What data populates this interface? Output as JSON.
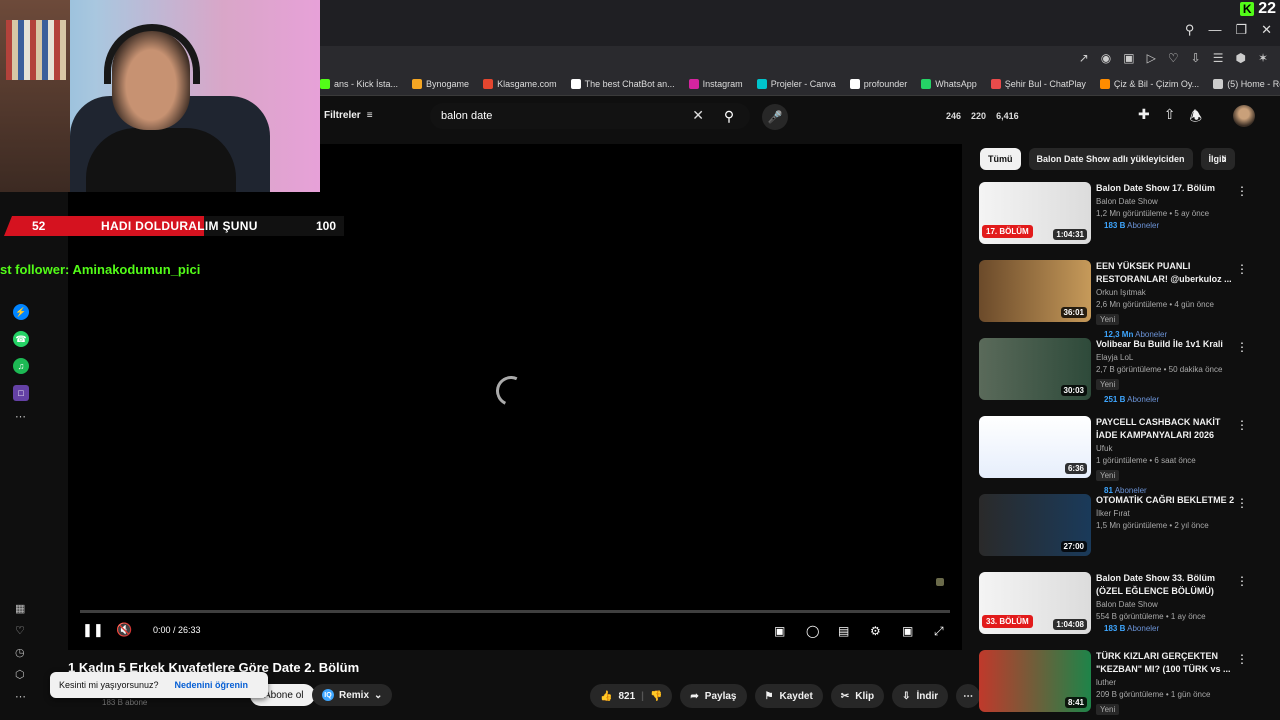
{
  "browser": {
    "kick_count": "22",
    "bookmarks": [
      {
        "label": "ans - Kick İsta...",
        "color": "#53fc18"
      },
      {
        "label": "Bynogame",
        "color": "#f5a623"
      },
      {
        "label": "Klasgame.com",
        "color": "#e3462f"
      },
      {
        "label": "The best ChatBot an...",
        "color": "#ffffff"
      },
      {
        "label": "Instagram",
        "color": "#d6249f"
      },
      {
        "label": "Projeler - Canva",
        "color": "#00c4cc"
      },
      {
        "label": "profounder",
        "color": "#ffffff"
      },
      {
        "label": "WhatsApp",
        "color": "#25d366"
      },
      {
        "label": "Şehir Bul - ChatPlay",
        "color": "#e94b4b"
      },
      {
        "label": "Çiz & Bil - Çizim Oy...",
        "color": "#ff8c00"
      },
      {
        "label": "(5) Home - Roblox",
        "color": "#cccccc"
      }
    ]
  },
  "header": {
    "filters_label": "Filtreler",
    "search_value": "balon date",
    "stats": [
      "246",
      "220",
      "6,416"
    ]
  },
  "overlay": {
    "goal_current": "52",
    "goal_label": "HADI DOLDURALIM ŞUNU",
    "goal_max": "100",
    "goal_fraction": 0.52,
    "last_follower": "st follower: Aminakodumun_pici"
  },
  "player": {
    "time": "0:00 / 26:33",
    "title": "1 Kadın 5 Erkek Kıyafetlere Göre Date 2. Bölüm",
    "subscribers": "183 B abone"
  },
  "interrupt": {
    "question": "Kesinti mi yaşıyorsunuz?",
    "learn": "Nedenini öğrenin"
  },
  "below": {
    "subscribe_label": "Abone ol",
    "remix_label": "Remix",
    "like_count": "821",
    "share_label": "Paylaş",
    "save_label": "Kaydet",
    "clip_label": "Klip",
    "download_label": "İndir"
  },
  "chips": [
    "Tümü",
    "Balon Date Show adlı yükleyiciden",
    "İlgili"
  ],
  "recommendations": [
    {
      "title": "Balon Date Show 17. Bölüm",
      "channel": "Balon Date Show",
      "meta": "1,2 Mn görüntüleme • 5 ay önce",
      "subs": "183 B",
      "subs_label": "Aboneler",
      "duration": "1:04:31",
      "tag": "17. BÖLÜM",
      "new": "",
      "thumb": "linear-gradient(90deg,#f4f4f4,#dcdcdc)"
    },
    {
      "title": "EEN YÜKSEK PUANLI RESTORANLAR! @uberkuloz ...",
      "channel": "Orkun Işıtmak",
      "meta": "2,6 Mn görüntüleme • 4 gün önce",
      "subs": "12,3 Mn",
      "subs_label": "Aboneler",
      "duration": "36:01",
      "tag": "",
      "new": "Yeni",
      "thumb": "linear-gradient(90deg,#6b4a2a,#c69a5a)"
    },
    {
      "title": "Volibear Bu Build İle 1v1 Krali",
      "channel": "Elayja LoL",
      "meta": "2,7 B görüntüleme • 50 dakika önce",
      "subs": "251 B",
      "subs_label": "Aboneler",
      "duration": "30:03",
      "tag": "",
      "new": "Yeni",
      "thumb": "linear-gradient(90deg,#5a6a5a,#2e4a3a)"
    },
    {
      "title": "PAYCELL CASHBACK NAKİT İADE KAMPANYALARI 2026",
      "channel": "Ufuk",
      "meta": "1 görüntüleme • 6 saat önce",
      "subs": "81",
      "subs_label": "Aboneler",
      "duration": "6:36",
      "tag": "",
      "new": "Yeni",
      "thumb": "linear-gradient(180deg,#ffffff,#e6eefc)"
    },
    {
      "title": "OTOMATİK CAĞRI BEKLETME 2",
      "channel": "İlker Fırat",
      "meta": "1,5 Mn görüntüleme • 2 yıl önce",
      "subs": "",
      "subs_label": "",
      "duration": "27:00",
      "tag": "",
      "new": "",
      "thumb": "linear-gradient(90deg,#2a2a2a,#1a3a5a)"
    },
    {
      "title": "Balon Date Show 33. Bölüm (ÖZEL EĞLENCE BÖLÜMÜ)",
      "channel": "Balon Date Show",
      "meta": "554 B görüntüleme • 1 ay önce",
      "subs": "183 B",
      "subs_label": "Aboneler",
      "duration": "1:04:08",
      "tag": "33. BÖLÜM",
      "new": "",
      "thumb": "linear-gradient(90deg,#f4f4f4,#dcdcdc)"
    },
    {
      "title": "TÜRK KIZLARI GERÇEKTEN \"KEZBAN\" MI? (100 TÜRK vs ...",
      "channel": "luther",
      "meta": "209 B görüntüleme • 1 gün önce",
      "subs": "",
      "subs_label": "",
      "duration": "8:41",
      "tag": "",
      "new": "Yeni",
      "thumb": "linear-gradient(90deg,#c0392b,#1e8449)"
    }
  ]
}
